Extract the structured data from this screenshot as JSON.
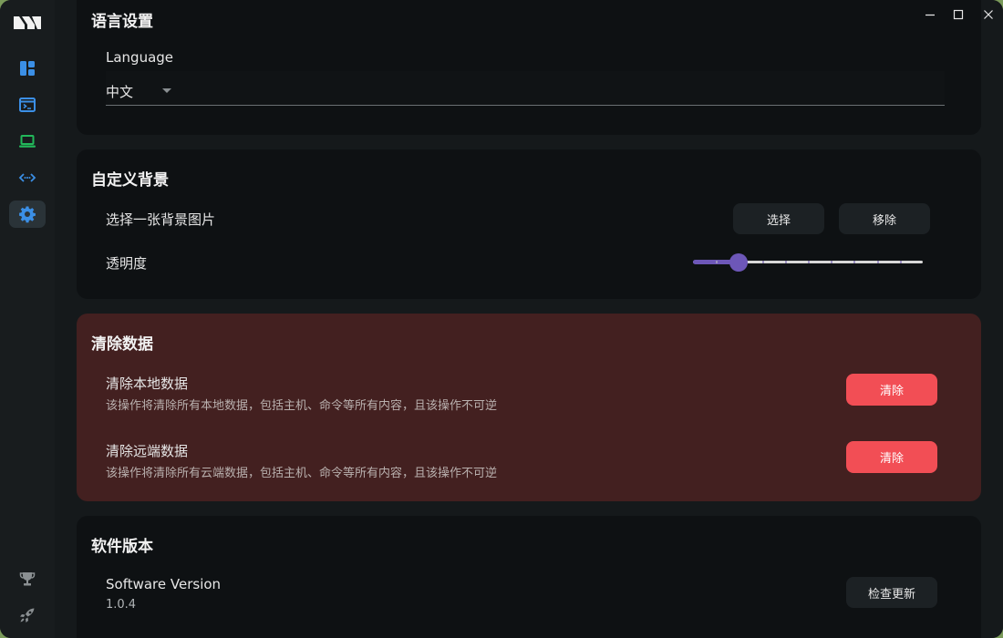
{
  "window_controls": {
    "minimize": "minimize-icon",
    "maximize": "maximize-icon",
    "close": "close-icon"
  },
  "sidebar": {
    "items": [
      {
        "name": "dashboard",
        "icon": "dashboard-icon",
        "color": "#3b8fe6"
      },
      {
        "name": "terminal",
        "icon": "terminal-icon",
        "color": "#3b8fe6"
      },
      {
        "name": "hosts",
        "icon": "laptop-icon",
        "color": "#22b85a"
      },
      {
        "name": "code",
        "icon": "code-icon",
        "color": "#3b8fe6"
      },
      {
        "name": "settings",
        "icon": "gear-icon",
        "color": "#3b8fe6",
        "active": true
      }
    ],
    "bottom_items": [
      {
        "name": "trophy",
        "icon": "trophy-icon"
      },
      {
        "name": "rocket",
        "icon": "rocket-icon"
      }
    ]
  },
  "language_section": {
    "title": "语言设置",
    "label": "Language",
    "selected": "中文"
  },
  "background_section": {
    "title": "自定义背景",
    "choose_label": "选择一张背景图片",
    "select_button": "选择",
    "remove_button": "移除",
    "opacity_label": "透明度",
    "opacity_value": 0.2,
    "opacity_steps": 10
  },
  "clear_section": {
    "title": "清除数据",
    "accent_color": "#f24e55",
    "local": {
      "label": "清除本地数据",
      "description": "该操作将清除所有本地数据，包括主机、命令等所有内容，且该操作不可逆",
      "button": "清除"
    },
    "remote": {
      "label": "清除远端数据",
      "description": "该操作将清除所有云端数据，包括主机、命令等所有内容，且该操作不可逆",
      "button": "清除"
    }
  },
  "version_section": {
    "title": "软件版本",
    "label": "Software Version",
    "version": "1.0.4",
    "check_button": "检查更新"
  }
}
